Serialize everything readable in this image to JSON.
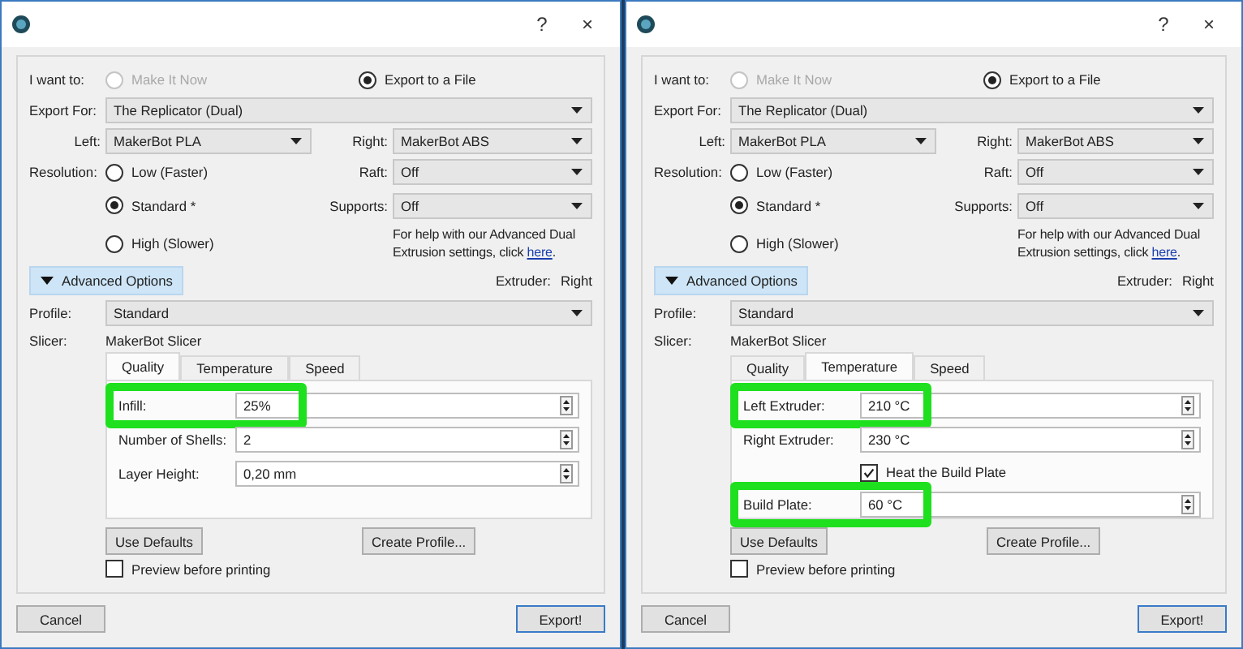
{
  "dialogs": [
    {
      "title_buttons": [
        "?",
        "×"
      ],
      "intent": {
        "label": "I want to:",
        "options": [
          {
            "label": "Make It Now",
            "selected": false,
            "disabled": true
          },
          {
            "label": "Export to a File",
            "selected": true,
            "disabled": false
          }
        ]
      },
      "export_for": {
        "label": "Export For:",
        "value": "The Replicator (Dual)"
      },
      "left": {
        "label": "Left:",
        "value": "MakerBot PLA"
      },
      "right": {
        "label": "Right:",
        "value": "MakerBot ABS"
      },
      "resolution": {
        "label": "Resolution:",
        "options": [
          {
            "label": "Low (Faster)",
            "selected": false
          },
          {
            "label": "Standard *",
            "selected": true
          },
          {
            "label": "High (Slower)",
            "selected": false
          }
        ]
      },
      "raft": {
        "label": "Raft:",
        "value": "Off"
      },
      "supports": {
        "label": "Supports:",
        "value": "Off"
      },
      "help": {
        "text": "For help with our Advanced Dual Extrusion settings, click ",
        "link": "here",
        "end": "."
      },
      "advanced": {
        "label": "Advanced Options",
        "expanded": true
      },
      "extruder": {
        "label": "Extruder:",
        "value": "Right"
      },
      "profile": {
        "label": "Profile:",
        "value": "Standard"
      },
      "slicer": {
        "label": "Slicer:",
        "value": "MakerBot Slicer"
      },
      "tabs": [
        {
          "label": "Quality",
          "selected": true
        },
        {
          "label": "Temperature",
          "selected": false
        },
        {
          "label": "Speed",
          "selected": false
        }
      ],
      "panel_rows": [
        {
          "kind": "spin",
          "label": "Infill:",
          "value": "25%",
          "highlighted": true
        },
        {
          "kind": "spin",
          "label": "Number of Shells:",
          "value": "2",
          "highlighted": false
        },
        {
          "kind": "spin",
          "label": "Layer Height:",
          "value": "0,20 mm",
          "highlighted": false
        }
      ],
      "use_defaults": "Use Defaults",
      "create_profile": "Create Profile...",
      "preview": {
        "label": "Preview before printing",
        "checked": false
      },
      "cancel": "Cancel",
      "export": "Export!"
    },
    {
      "title_buttons": [
        "?",
        "×"
      ],
      "intent": {
        "label": "I want to:",
        "options": [
          {
            "label": "Make It Now",
            "selected": false,
            "disabled": true
          },
          {
            "label": "Export to a File",
            "selected": true,
            "disabled": false
          }
        ]
      },
      "export_for": {
        "label": "Export For:",
        "value": "The Replicator (Dual)"
      },
      "left": {
        "label": "Left:",
        "value": "MakerBot PLA"
      },
      "right": {
        "label": "Right:",
        "value": "MakerBot ABS"
      },
      "resolution": {
        "label": "Resolution:",
        "options": [
          {
            "label": "Low (Faster)",
            "selected": false
          },
          {
            "label": "Standard *",
            "selected": true
          },
          {
            "label": "High (Slower)",
            "selected": false
          }
        ]
      },
      "raft": {
        "label": "Raft:",
        "value": "Off"
      },
      "supports": {
        "label": "Supports:",
        "value": "Off"
      },
      "help": {
        "text": "For help with our Advanced Dual Extrusion settings, click ",
        "link": "here",
        "end": "."
      },
      "advanced": {
        "label": "Advanced Options",
        "expanded": true
      },
      "extruder": {
        "label": "Extruder:",
        "value": "Right"
      },
      "profile": {
        "label": "Profile:",
        "value": "Standard"
      },
      "slicer": {
        "label": "Slicer:",
        "value": "MakerBot Slicer"
      },
      "tabs": [
        {
          "label": "Quality",
          "selected": false
        },
        {
          "label": "Temperature",
          "selected": true
        },
        {
          "label": "Speed",
          "selected": false
        }
      ],
      "panel_rows": [
        {
          "kind": "spin",
          "label": "Left Extruder:",
          "value": "210 °C",
          "highlighted": true
        },
        {
          "kind": "spin",
          "label": "Right Extruder:",
          "value": "230 °C",
          "highlighted": false
        },
        {
          "kind": "checkbox",
          "label": "Heat the Build Plate",
          "checked": true
        },
        {
          "kind": "spin",
          "label": "Build Plate:",
          "value": "60 °C",
          "highlighted": true
        }
      ],
      "use_defaults": "Use Defaults",
      "create_profile": "Create Profile...",
      "preview": {
        "label": "Preview before printing",
        "checked": false
      },
      "cancel": "Cancel",
      "export": "Export!"
    }
  ]
}
